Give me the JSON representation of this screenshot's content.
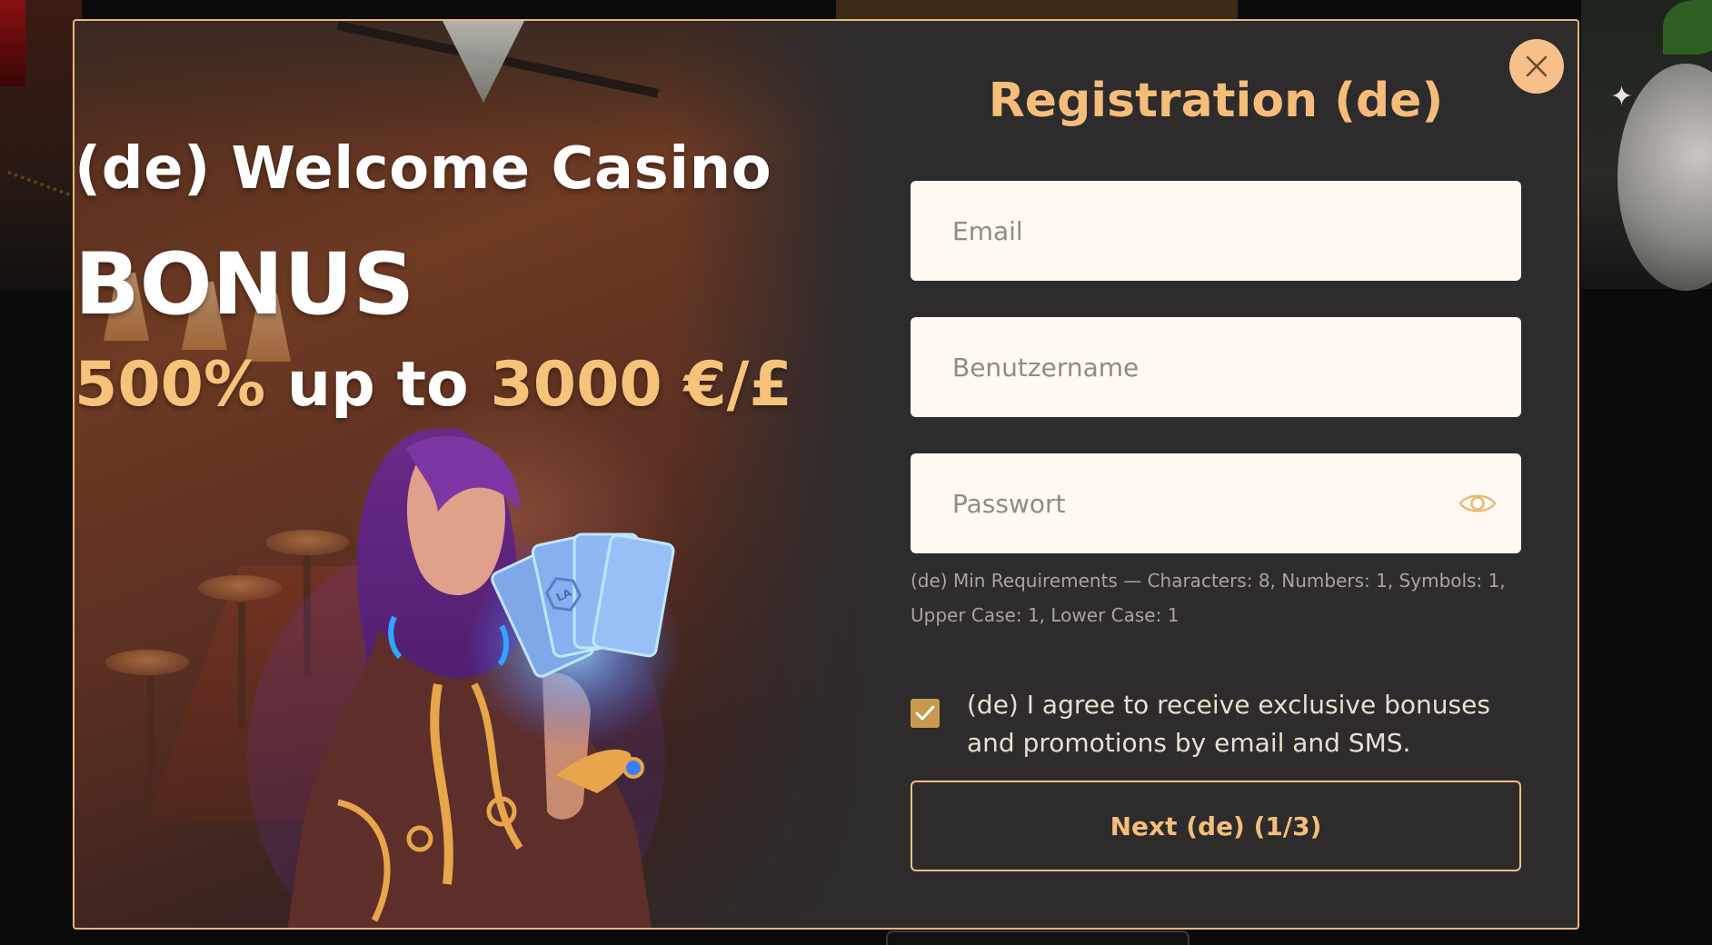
{
  "promo": {
    "title": "(de) Welcome Casino",
    "bonus": "BONUS",
    "offer_percent": "500%",
    "offer_mid": "up to",
    "offer_amount": "3000 €/£",
    "card_mark": "LA"
  },
  "form": {
    "title": "Registration (de)",
    "close_icon": "close-icon",
    "email": {
      "value": "",
      "placeholder": "Email"
    },
    "username": {
      "value": "",
      "placeholder": "Benutzername"
    },
    "password": {
      "value": "",
      "placeholder": "Passwort",
      "icon": "eye-icon"
    },
    "hint_line1": "(de) Min Requirements — Characters: 8, Numbers: 1, Symbols: 1,",
    "hint_line2": "Upper Case: 1, Lower Case: 1",
    "consent_checked": true,
    "consent_text": "(de) I agree to receive exclusive bonuses and promotions by email and SMS.",
    "next_label": "Next (de) (1/3)"
  },
  "colors": {
    "accent": "#f5bd79",
    "border": "#e9b877",
    "panel": "#2d2b2c",
    "field_bg": "#fff9f2",
    "checkbox": "#c9994f"
  }
}
